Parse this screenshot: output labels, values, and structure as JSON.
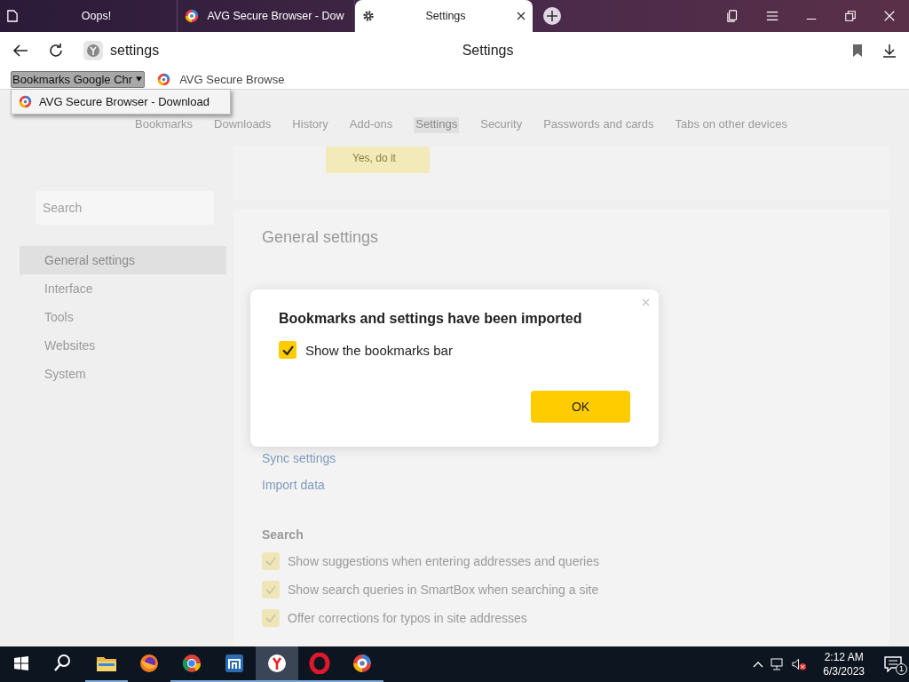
{
  "tabs": [
    {
      "title": "Oops!",
      "kind": "page",
      "selected": false
    },
    {
      "title": "AVG Secure Browser - Dow",
      "kind": "avg",
      "selected": false
    },
    {
      "title": "Settings",
      "kind": "gear",
      "selected": true
    }
  ],
  "address_bar": {
    "value": "settings",
    "page_title": "Settings"
  },
  "bookmarks_bar": [
    {
      "label": "Bookmarks Google Chr",
      "kind": "folder",
      "expanded": true
    },
    {
      "label": "AVG Secure Browse",
      "kind": "link"
    }
  ],
  "bookmark_menu": [
    {
      "label": "AVG Secure Browser - Download"
    }
  ],
  "settings_nav": [
    {
      "label": "Bookmarks",
      "selected": false
    },
    {
      "label": "Downloads",
      "selected": false
    },
    {
      "label": "History",
      "selected": false
    },
    {
      "label": "Add-ons",
      "selected": false
    },
    {
      "label": "Settings",
      "selected": true
    },
    {
      "label": "Security",
      "selected": false
    },
    {
      "label": "Passwords and cards",
      "selected": false
    },
    {
      "label": "Tabs on other devices",
      "selected": false
    }
  ],
  "banner_button": "Yes, do it",
  "sidebar": {
    "search_placeholder": "Search",
    "items": [
      {
        "label": "General settings",
        "selected": true
      },
      {
        "label": "Interface",
        "selected": false
      },
      {
        "label": "Tools",
        "selected": false
      },
      {
        "label": "Websites",
        "selected": false
      },
      {
        "label": "System",
        "selected": false
      }
    ]
  },
  "section_title": "General settings",
  "links": [
    "Sync settings",
    "Import data"
  ],
  "search_section": {
    "title": "Search",
    "options": [
      {
        "label": "Show suggestions when entering addresses and queries",
        "checked": true
      },
      {
        "label": "Show search queries in SmartBox when searching a site",
        "checked": true
      },
      {
        "label": "Offer corrections for typos in site addresses",
        "checked": true
      }
    ]
  },
  "dialog": {
    "title": "Bookmarks and settings have been imported",
    "checkbox": {
      "label": "Show the bookmarks bar",
      "checked": true
    },
    "button": "OK"
  },
  "taskbar": {
    "apps": [
      {
        "kind": "search",
        "running": false,
        "selected": false
      },
      {
        "kind": "explorer",
        "running": true,
        "selected": false
      },
      {
        "kind": "firefox",
        "running": false,
        "selected": false
      },
      {
        "kind": "chrome",
        "running": true,
        "selected": false
      },
      {
        "kind": "maxthon",
        "running": true,
        "selected": false
      },
      {
        "kind": "yandex",
        "running": true,
        "selected": true
      },
      {
        "kind": "opera",
        "running": true,
        "selected": false
      },
      {
        "kind": "avg",
        "running": true,
        "selected": false
      }
    ],
    "time": "2:12 AM",
    "date": "6/3/2023",
    "notifications": "1"
  }
}
